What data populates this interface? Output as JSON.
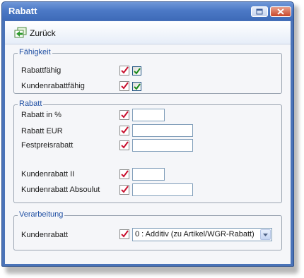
{
  "window": {
    "title": "Rabatt"
  },
  "toolbar": {
    "back_label": "Zurück"
  },
  "groups": {
    "faehigkeit": {
      "title": "Fähigkeit",
      "rows": [
        {
          "label": "Rabattfähig",
          "checked": true
        },
        {
          "label": "Kundenrabattfähig",
          "checked": true
        }
      ]
    },
    "rabatt": {
      "title": "Rabatt",
      "rows": [
        {
          "label": "Rabatt in %",
          "value": ""
        },
        {
          "label": "Rabatt EUR",
          "value": ""
        },
        {
          "label": "Festpreisrabatt",
          "value": ""
        },
        {
          "label": "Kundenrabatt II",
          "value": ""
        },
        {
          "label": "Kundenrabatt Absoulut",
          "value": ""
        }
      ]
    },
    "verarbeitung": {
      "title": "Verarbeitung",
      "rows": [
        {
          "label": "Kundenrabatt",
          "selected": "0 : Additiv (zu Artikel/WGR-Rabatt)"
        }
      ]
    }
  },
  "colors": {
    "title_bar": "#4c79c6",
    "group_title": "#1f4fa3",
    "flag_red": "#c8102e"
  }
}
